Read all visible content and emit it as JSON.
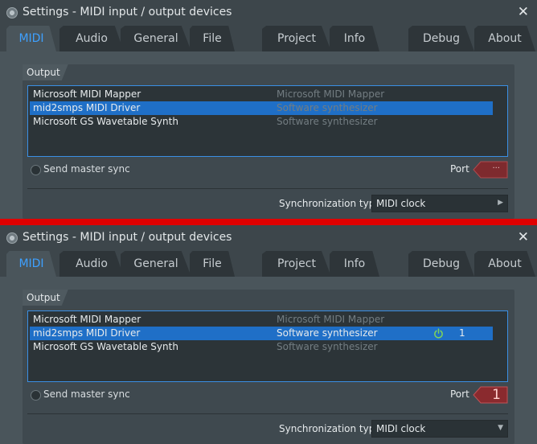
{
  "window_title": "Settings - MIDI input / output devices",
  "close_glyph": "✕",
  "tabs": [
    "MIDI",
    "Audio",
    "General",
    "File",
    "Project",
    "Info",
    "Debug",
    "About"
  ],
  "output_group_label": "Output",
  "devices": [
    {
      "name": "Microsoft MIDI Mapper",
      "type": "Microsoft MIDI Mapper"
    },
    {
      "name": "mid2smps MIDI Driver",
      "type": "Software synthesizer"
    },
    {
      "name": "Microsoft GS Wavetable Synth",
      "type": "Software synthesizer"
    }
  ],
  "send_master_sync_label": "Send master sync",
  "port_label": "Port",
  "sync_type_label": "Synchronization type",
  "sync_type_value": "MIDI clock",
  "before": {
    "port_value": "···",
    "sync_arrow": "▶"
  },
  "after": {
    "selected_port_number": "1",
    "port_value": "1",
    "sync_arrow": "▼",
    "power_icon": "power-icon-active"
  },
  "colors": {
    "accent_blue": "#3ea0ff",
    "selection": "#1f6fc7",
    "port_red": "#8a2a2e",
    "divider_red": "#e00000",
    "power_green": "#7fd35a"
  }
}
